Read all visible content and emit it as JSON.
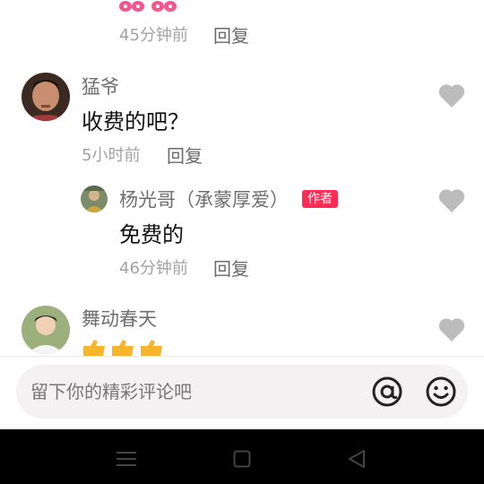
{
  "comments": [
    {
      "reaction_icon": "pink-emoji-icon",
      "time": "45分钟前",
      "reply_label": "回复"
    },
    {
      "username": "猛爷",
      "text": "收费的吧？",
      "time": "5小时前",
      "reply_label": "回复",
      "avatar_icon": "user-avatar",
      "like_icon": "heart-icon"
    },
    {
      "username": "杨光哥（承蒙厚爱）",
      "badge": "作者",
      "text": "免费的",
      "time": "46分钟前",
      "reply_label": "回复",
      "avatar_icon": "author-avatar",
      "like_icon": "heart-icon"
    },
    {
      "username": "舞动春天",
      "reaction_icon": "thumbs-up-emoji-icon",
      "avatar_icon": "user-avatar",
      "like_icon": "heart-icon"
    }
  ],
  "input_bar": {
    "placeholder": "留下你的精彩评论吧",
    "mention_icon": "at-icon",
    "emoji_icon": "smiley-icon"
  },
  "system_nav": {
    "menu_icon": "menu-icon",
    "home_icon": "home-square-icon",
    "back_icon": "back-triangle-icon"
  },
  "colors": {
    "accent": "#fe2c55",
    "heart": "#bcbcbc",
    "input_bg": "#f4f1f3",
    "nav_bg": "#000000"
  }
}
